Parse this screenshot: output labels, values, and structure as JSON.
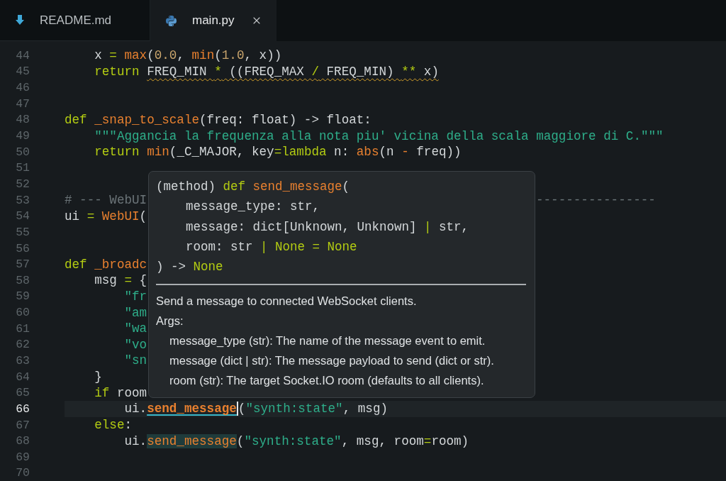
{
  "tabs": [
    {
      "label": "README.md",
      "kind": "markdown",
      "selected": false,
      "closable": false
    },
    {
      "label": "main.py",
      "kind": "python",
      "selected": true,
      "closable": true
    }
  ],
  "editor": {
    "lines": [
      {
        "number": "44",
        "current": false,
        "tokens": [
          {
            "kind": "plain",
            "text": "    x "
          },
          {
            "kind": "op",
            "text": "="
          },
          {
            "kind": "fn",
            "text": " max"
          },
          {
            "kind": "plain",
            "text": "("
          },
          {
            "kind": "num",
            "text": "0.0"
          },
          {
            "kind": "plain",
            "text": ", "
          },
          {
            "kind": "fn",
            "text": "min"
          },
          {
            "kind": "plain",
            "text": "("
          },
          {
            "kind": "num",
            "text": "1.0"
          },
          {
            "kind": "plain",
            "text": ", x))"
          }
        ]
      },
      {
        "number": "45",
        "current": false,
        "tokens": [
          {
            "kind": "kw",
            "text": "    return "
          },
          {
            "kind": "plain",
            "text": "FREQ_MIN ",
            "warning": true
          },
          {
            "kind": "op",
            "text": "*",
            "warning": true
          },
          {
            "kind": "plain",
            "text": " ((FREQ_MAX ",
            "warning": true
          },
          {
            "kind": "op",
            "text": "/",
            "warning": true
          },
          {
            "kind": "plain",
            "text": " FREQ_MIN) ",
            "warning": true
          },
          {
            "kind": "op",
            "text": "**",
            "warning": true
          },
          {
            "kind": "plain",
            "text": " x)",
            "warning": true
          }
        ]
      },
      {
        "number": "46",
        "current": false
      },
      {
        "number": "47",
        "current": false
      },
      {
        "number": "48",
        "current": false,
        "tokens": [
          {
            "kind": "kw",
            "text": "def "
          },
          {
            "kind": "fn",
            "text": "_snap_to_scale"
          },
          {
            "kind": "plain",
            "text": "(freq: float) -> float:"
          }
        ]
      },
      {
        "number": "49",
        "current": false,
        "tokens": [
          {
            "kind": "str",
            "text": "    \"\"\"Aggancia la frequenza alla nota piu' vicina della scala maggiore di C.\"\"\""
          }
        ]
      },
      {
        "number": "50",
        "current": false,
        "tokens": [
          {
            "kind": "kw",
            "text": "    return "
          },
          {
            "kind": "fn",
            "text": "min"
          },
          {
            "kind": "plain",
            "text": "(_C_MAJOR, key"
          },
          {
            "kind": "op",
            "text": "="
          },
          {
            "kind": "kw",
            "text": "lambda"
          },
          {
            "kind": "plain",
            "text": " n: "
          },
          {
            "kind": "fn",
            "text": "abs"
          },
          {
            "kind": "plain",
            "text": "(n "
          },
          {
            "kind": "fn",
            "text": "-"
          },
          {
            "kind": "plain",
            "text": " freq))"
          }
        ]
      },
      {
        "number": "51",
        "current": false
      },
      {
        "number": "52",
        "current": false
      },
      {
        "number": "53",
        "current": false,
        "tokens": [
          {
            "kind": "comment",
            "text": "# --- WebUI"
          }
        ],
        "after_popup": [
          {
            "kind": "comment",
            "text": "----------------"
          }
        ]
      },
      {
        "number": "54",
        "current": false,
        "tokens": [
          {
            "kind": "plain",
            "text": "ui "
          },
          {
            "kind": "op",
            "text": "="
          },
          {
            "kind": "fn",
            "text": " WebUI"
          },
          {
            "kind": "plain",
            "text": "("
          }
        ]
      },
      {
        "number": "55",
        "current": false
      },
      {
        "number": "56",
        "current": false
      },
      {
        "number": "57",
        "current": false,
        "tokens": [
          {
            "kind": "kw",
            "text": "def "
          },
          {
            "kind": "fn",
            "text": "_broadc"
          }
        ]
      },
      {
        "number": "58",
        "current": false,
        "tokens": [
          {
            "kind": "plain",
            "text": "    msg "
          },
          {
            "kind": "op",
            "text": "="
          },
          {
            "kind": "plain",
            "text": " {"
          }
        ]
      },
      {
        "number": "59",
        "current": false,
        "tokens": [
          {
            "kind": "str",
            "text": "        \"fr"
          }
        ]
      },
      {
        "number": "60",
        "current": false,
        "tokens": [
          {
            "kind": "str",
            "text": "        \"am"
          }
        ]
      },
      {
        "number": "61",
        "current": false,
        "tokens": [
          {
            "kind": "str",
            "text": "        \"wa"
          }
        ]
      },
      {
        "number": "62",
        "current": false,
        "tokens": [
          {
            "kind": "str",
            "text": "        \"vo"
          }
        ]
      },
      {
        "number": "63",
        "current": false,
        "tokens": [
          {
            "kind": "str",
            "text": "        \"sn"
          }
        ]
      },
      {
        "number": "64",
        "current": false,
        "tokens": [
          {
            "kind": "plain",
            "text": "    }"
          }
        ]
      },
      {
        "number": "65",
        "current": false,
        "tokens": [
          {
            "kind": "kw",
            "text": "    if"
          },
          {
            "kind": "plain",
            "text": " room"
          }
        ]
      },
      {
        "number": "66",
        "current": true,
        "tokens": [
          {
            "kind": "plain",
            "text": "        ui."
          },
          {
            "kind": "fn_write",
            "text": "send_message",
            "caret": true
          },
          {
            "kind": "plain",
            "text": "("
          },
          {
            "kind": "str",
            "text": "\"synth:state\""
          },
          {
            "kind": "plain",
            "text": ", msg)"
          }
        ]
      },
      {
        "number": "67",
        "current": false,
        "tokens": [
          {
            "kind": "kw",
            "text": "    else"
          },
          {
            "kind": "plain",
            "text": ":"
          }
        ]
      },
      {
        "number": "68",
        "current": false,
        "tokens": [
          {
            "kind": "plain",
            "text": "        ui."
          },
          {
            "kind": "fn_read",
            "text": "send_message"
          },
          {
            "kind": "plain",
            "text": "("
          },
          {
            "kind": "str",
            "text": "\"synth:state\""
          },
          {
            "kind": "plain",
            "text": ", msg, room"
          },
          {
            "kind": "op",
            "text": "="
          },
          {
            "kind": "plain",
            "text": "room)"
          }
        ]
      },
      {
        "number": "69",
        "current": false
      },
      {
        "number": "70",
        "current": false
      }
    ]
  },
  "hover_popup": {
    "signature": [
      [
        {
          "kind": "plain",
          "text": "(method) "
        },
        {
          "kind": "kw",
          "text": "def "
        },
        {
          "kind": "fn",
          "text": "send_message"
        },
        {
          "kind": "plain",
          "text": "("
        }
      ],
      [
        {
          "kind": "plain",
          "text": "    message_type: str,"
        }
      ],
      [
        {
          "kind": "plain",
          "text": "    message: dict[Unknown, Unknown] "
        },
        {
          "kind": "op",
          "text": "|"
        },
        {
          "kind": "plain",
          "text": " str,"
        }
      ],
      [
        {
          "kind": "plain",
          "text": "    room: str "
        },
        {
          "kind": "op",
          "text": "|"
        },
        {
          "kind": "kw",
          "text": " None "
        },
        {
          "kind": "op",
          "text": "="
        },
        {
          "kind": "kw",
          "text": " None"
        }
      ],
      [
        {
          "kind": "plain",
          "text": ") -> "
        },
        {
          "kind": "kw",
          "text": "None"
        }
      ]
    ],
    "summary": "Send a message to connected WebSocket clients.",
    "args_heading": "Args:",
    "args": [
      "message_type (str): The name of the message event to emit.",
      "message (dict | str): The message payload to send (dict or str).",
      "room (str): The target Socket.IO room (defaults to all clients)."
    ]
  }
}
